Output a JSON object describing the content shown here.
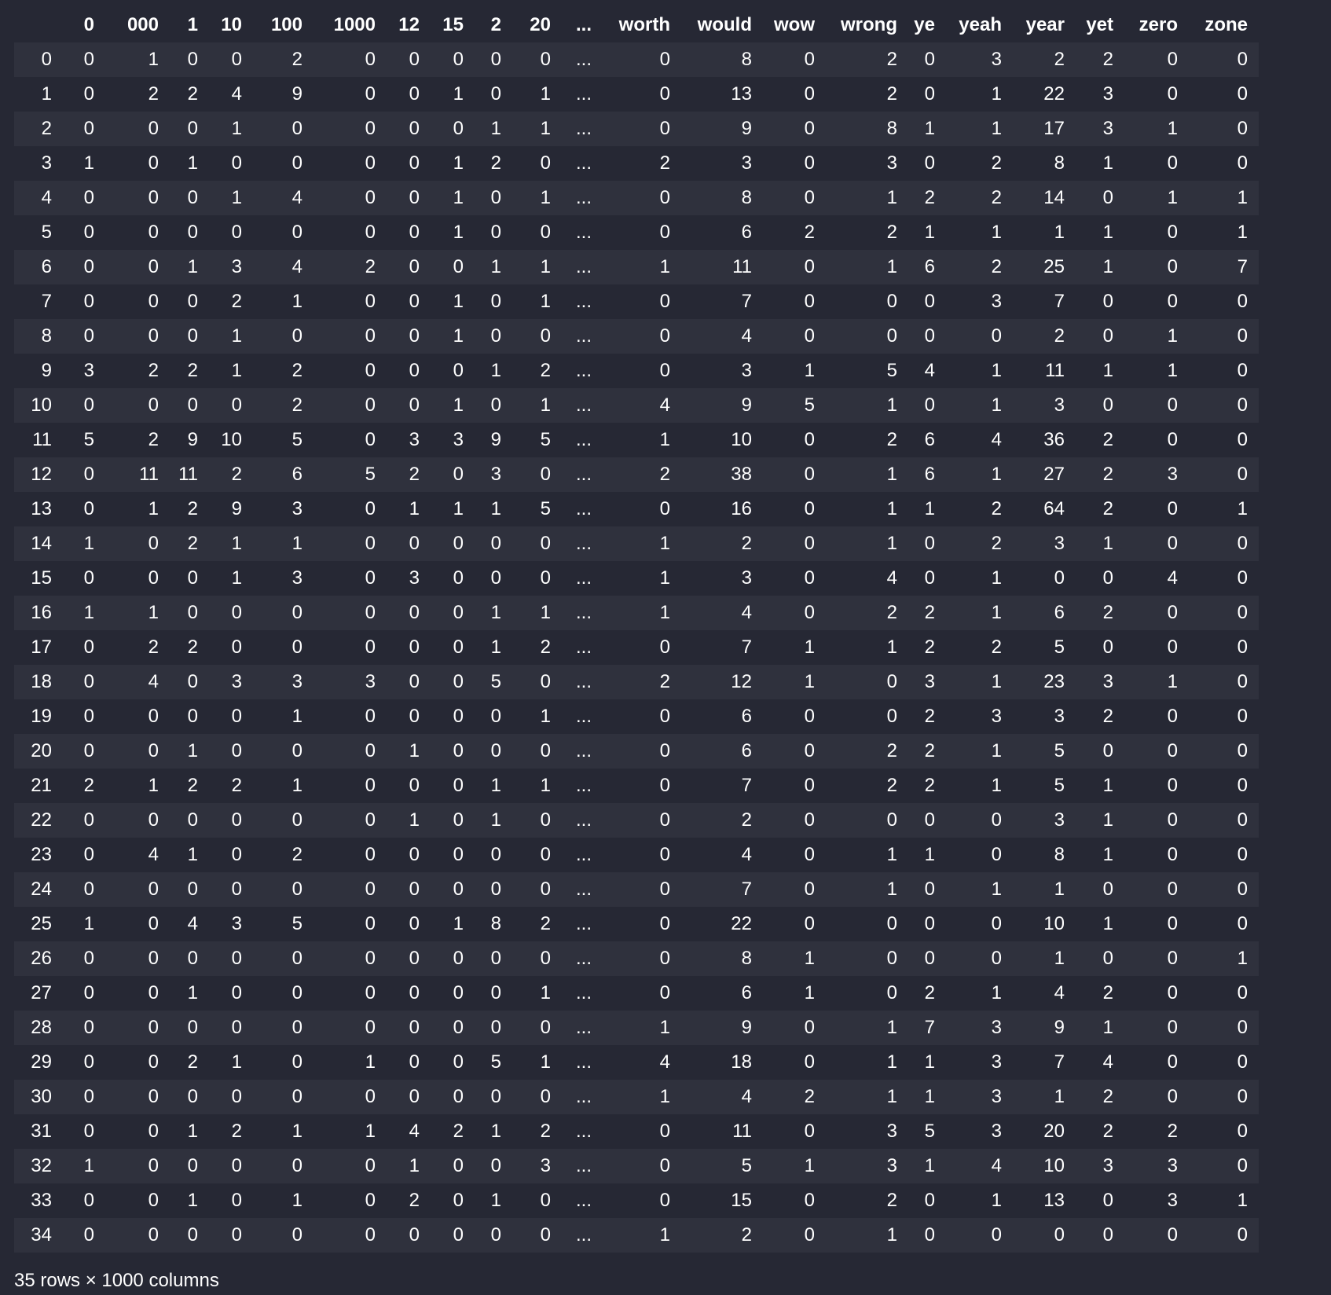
{
  "dataframe": {
    "columns": [
      "",
      "0",
      "000",
      "1",
      "10",
      "100",
      "1000",
      "12",
      "15",
      "2",
      "20",
      "...",
      "worth",
      "would",
      "wow",
      "wrong",
      "ye",
      "yeah",
      "year",
      "yet",
      "zero",
      "zone"
    ],
    "rows": [
      [
        "0",
        "0",
        "1",
        "0",
        "0",
        "2",
        "0",
        "0",
        "0",
        "0",
        "0",
        "...",
        "0",
        "8",
        "0",
        "2",
        "0",
        "3",
        "2",
        "2",
        "0",
        "0"
      ],
      [
        "1",
        "0",
        "2",
        "2",
        "4",
        "9",
        "0",
        "0",
        "1",
        "0",
        "1",
        "...",
        "0",
        "13",
        "0",
        "2",
        "0",
        "1",
        "22",
        "3",
        "0",
        "0"
      ],
      [
        "2",
        "0",
        "0",
        "0",
        "1",
        "0",
        "0",
        "0",
        "0",
        "1",
        "1",
        "...",
        "0",
        "9",
        "0",
        "8",
        "1",
        "1",
        "17",
        "3",
        "1",
        "0"
      ],
      [
        "3",
        "1",
        "0",
        "1",
        "0",
        "0",
        "0",
        "0",
        "1",
        "2",
        "0",
        "...",
        "2",
        "3",
        "0",
        "3",
        "0",
        "2",
        "8",
        "1",
        "0",
        "0"
      ],
      [
        "4",
        "0",
        "0",
        "0",
        "1",
        "4",
        "0",
        "0",
        "1",
        "0",
        "1",
        "...",
        "0",
        "8",
        "0",
        "1",
        "2",
        "2",
        "14",
        "0",
        "1",
        "1"
      ],
      [
        "5",
        "0",
        "0",
        "0",
        "0",
        "0",
        "0",
        "0",
        "1",
        "0",
        "0",
        "...",
        "0",
        "6",
        "2",
        "2",
        "1",
        "1",
        "1",
        "1",
        "0",
        "1"
      ],
      [
        "6",
        "0",
        "0",
        "1",
        "3",
        "4",
        "2",
        "0",
        "0",
        "1",
        "1",
        "...",
        "1",
        "11",
        "0",
        "1",
        "6",
        "2",
        "25",
        "1",
        "0",
        "7"
      ],
      [
        "7",
        "0",
        "0",
        "0",
        "2",
        "1",
        "0",
        "0",
        "1",
        "0",
        "1",
        "...",
        "0",
        "7",
        "0",
        "0",
        "0",
        "3",
        "7",
        "0",
        "0",
        "0"
      ],
      [
        "8",
        "0",
        "0",
        "0",
        "1",
        "0",
        "0",
        "0",
        "1",
        "0",
        "0",
        "...",
        "0",
        "4",
        "0",
        "0",
        "0",
        "0",
        "2",
        "0",
        "1",
        "0"
      ],
      [
        "9",
        "3",
        "2",
        "2",
        "1",
        "2",
        "0",
        "0",
        "0",
        "1",
        "2",
        "...",
        "0",
        "3",
        "1",
        "5",
        "4",
        "1",
        "11",
        "1",
        "1",
        "0"
      ],
      [
        "10",
        "0",
        "0",
        "0",
        "0",
        "2",
        "0",
        "0",
        "1",
        "0",
        "1",
        "...",
        "4",
        "9",
        "5",
        "1",
        "0",
        "1",
        "3",
        "0",
        "0",
        "0"
      ],
      [
        "11",
        "5",
        "2",
        "9",
        "10",
        "5",
        "0",
        "3",
        "3",
        "9",
        "5",
        "...",
        "1",
        "10",
        "0",
        "2",
        "6",
        "4",
        "36",
        "2",
        "0",
        "0"
      ],
      [
        "12",
        "0",
        "11",
        "11",
        "2",
        "6",
        "5",
        "2",
        "0",
        "3",
        "0",
        "...",
        "2",
        "38",
        "0",
        "1",
        "6",
        "1",
        "27",
        "2",
        "3",
        "0"
      ],
      [
        "13",
        "0",
        "1",
        "2",
        "9",
        "3",
        "0",
        "1",
        "1",
        "1",
        "5",
        "...",
        "0",
        "16",
        "0",
        "1",
        "1",
        "2",
        "64",
        "2",
        "0",
        "1"
      ],
      [
        "14",
        "1",
        "0",
        "2",
        "1",
        "1",
        "0",
        "0",
        "0",
        "0",
        "0",
        "...",
        "1",
        "2",
        "0",
        "1",
        "0",
        "2",
        "3",
        "1",
        "0",
        "0"
      ],
      [
        "15",
        "0",
        "0",
        "0",
        "1",
        "3",
        "0",
        "3",
        "0",
        "0",
        "0",
        "...",
        "1",
        "3",
        "0",
        "4",
        "0",
        "1",
        "0",
        "0",
        "4",
        "0"
      ],
      [
        "16",
        "1",
        "1",
        "0",
        "0",
        "0",
        "0",
        "0",
        "0",
        "1",
        "1",
        "...",
        "1",
        "4",
        "0",
        "2",
        "2",
        "1",
        "6",
        "2",
        "0",
        "0"
      ],
      [
        "17",
        "0",
        "2",
        "2",
        "0",
        "0",
        "0",
        "0",
        "0",
        "1",
        "2",
        "...",
        "0",
        "7",
        "1",
        "1",
        "2",
        "2",
        "5",
        "0",
        "0",
        "0"
      ],
      [
        "18",
        "0",
        "4",
        "0",
        "3",
        "3",
        "3",
        "0",
        "0",
        "5",
        "0",
        "...",
        "2",
        "12",
        "1",
        "0",
        "3",
        "1",
        "23",
        "3",
        "1",
        "0"
      ],
      [
        "19",
        "0",
        "0",
        "0",
        "0",
        "1",
        "0",
        "0",
        "0",
        "0",
        "1",
        "...",
        "0",
        "6",
        "0",
        "0",
        "2",
        "3",
        "3",
        "2",
        "0",
        "0"
      ],
      [
        "20",
        "0",
        "0",
        "1",
        "0",
        "0",
        "0",
        "1",
        "0",
        "0",
        "0",
        "...",
        "0",
        "6",
        "0",
        "2",
        "2",
        "1",
        "5",
        "0",
        "0",
        "0"
      ],
      [
        "21",
        "2",
        "1",
        "2",
        "2",
        "1",
        "0",
        "0",
        "0",
        "1",
        "1",
        "...",
        "0",
        "7",
        "0",
        "2",
        "2",
        "1",
        "5",
        "1",
        "0",
        "0"
      ],
      [
        "22",
        "0",
        "0",
        "0",
        "0",
        "0",
        "0",
        "1",
        "0",
        "1",
        "0",
        "...",
        "0",
        "2",
        "0",
        "0",
        "0",
        "0",
        "3",
        "1",
        "0",
        "0"
      ],
      [
        "23",
        "0",
        "4",
        "1",
        "0",
        "2",
        "0",
        "0",
        "0",
        "0",
        "0",
        "...",
        "0",
        "4",
        "0",
        "1",
        "1",
        "0",
        "8",
        "1",
        "0",
        "0"
      ],
      [
        "24",
        "0",
        "0",
        "0",
        "0",
        "0",
        "0",
        "0",
        "0",
        "0",
        "0",
        "...",
        "0",
        "7",
        "0",
        "1",
        "0",
        "1",
        "1",
        "0",
        "0",
        "0"
      ],
      [
        "25",
        "1",
        "0",
        "4",
        "3",
        "5",
        "0",
        "0",
        "1",
        "8",
        "2",
        "...",
        "0",
        "22",
        "0",
        "0",
        "0",
        "0",
        "10",
        "1",
        "0",
        "0"
      ],
      [
        "26",
        "0",
        "0",
        "0",
        "0",
        "0",
        "0",
        "0",
        "0",
        "0",
        "0",
        "...",
        "0",
        "8",
        "1",
        "0",
        "0",
        "0",
        "1",
        "0",
        "0",
        "1"
      ],
      [
        "27",
        "0",
        "0",
        "1",
        "0",
        "0",
        "0",
        "0",
        "0",
        "0",
        "1",
        "...",
        "0",
        "6",
        "1",
        "0",
        "2",
        "1",
        "4",
        "2",
        "0",
        "0"
      ],
      [
        "28",
        "0",
        "0",
        "0",
        "0",
        "0",
        "0",
        "0",
        "0",
        "0",
        "0",
        "...",
        "1",
        "9",
        "0",
        "1",
        "7",
        "3",
        "9",
        "1",
        "0",
        "0"
      ],
      [
        "29",
        "0",
        "0",
        "2",
        "1",
        "0",
        "1",
        "0",
        "0",
        "5",
        "1",
        "...",
        "4",
        "18",
        "0",
        "1",
        "1",
        "3",
        "7",
        "4",
        "0",
        "0"
      ],
      [
        "30",
        "0",
        "0",
        "0",
        "0",
        "0",
        "0",
        "0",
        "0",
        "0",
        "0",
        "...",
        "1",
        "4",
        "2",
        "1",
        "1",
        "3",
        "1",
        "2",
        "0",
        "0"
      ],
      [
        "31",
        "0",
        "0",
        "1",
        "2",
        "1",
        "1",
        "4",
        "2",
        "1",
        "2",
        "...",
        "0",
        "11",
        "0",
        "3",
        "5",
        "3",
        "20",
        "2",
        "2",
        "0"
      ],
      [
        "32",
        "1",
        "0",
        "0",
        "0",
        "0",
        "0",
        "1",
        "0",
        "0",
        "3",
        "...",
        "0",
        "5",
        "1",
        "3",
        "1",
        "4",
        "10",
        "3",
        "3",
        "0"
      ],
      [
        "33",
        "0",
        "0",
        "1",
        "0",
        "1",
        "0",
        "2",
        "0",
        "1",
        "0",
        "...",
        "0",
        "15",
        "0",
        "2",
        "0",
        "1",
        "13",
        "0",
        "3",
        "1"
      ],
      [
        "34",
        "0",
        "0",
        "0",
        "0",
        "0",
        "0",
        "0",
        "0",
        "0",
        "0",
        "...",
        "1",
        "2",
        "0",
        "1",
        "0",
        "0",
        "0",
        "0",
        "0",
        "0"
      ]
    ]
  },
  "footer": {
    "shape": "35 rows × 1000 columns"
  }
}
